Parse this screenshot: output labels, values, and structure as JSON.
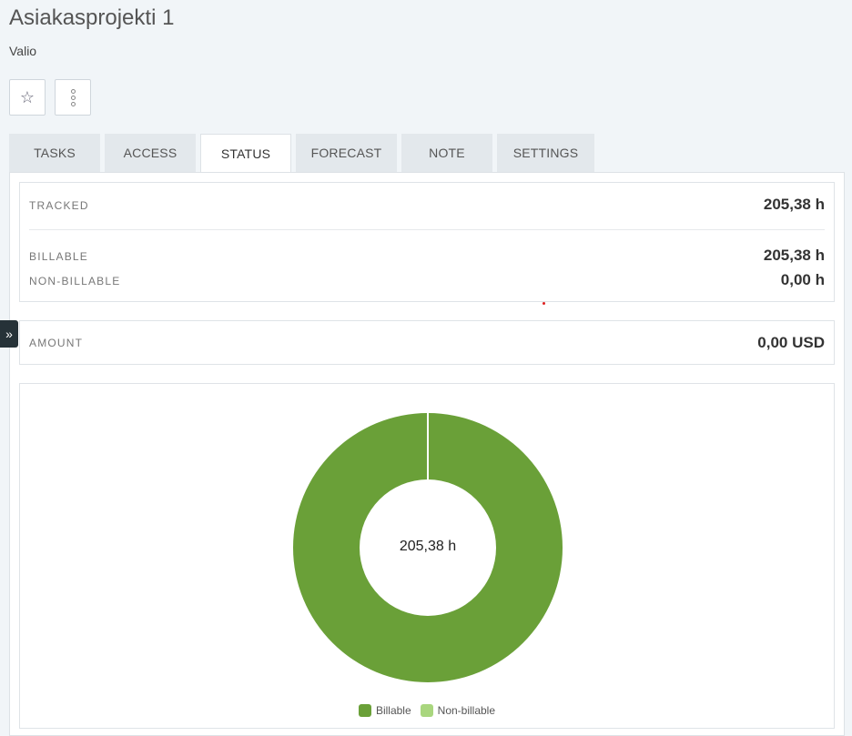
{
  "header": {
    "title": "Asiakasprojekti 1",
    "client": "Valio"
  },
  "actions": {
    "favorite_icon": "star-icon",
    "more_icon": "vertical-dots-icon",
    "star_glyph": "☆"
  },
  "tabs": [
    {
      "label": "TASKS",
      "active": false
    },
    {
      "label": "ACCESS",
      "active": false
    },
    {
      "label": "STATUS",
      "active": true
    },
    {
      "label": "FORECAST",
      "active": false
    },
    {
      "label": "NOTE",
      "active": false
    },
    {
      "label": "SETTINGS",
      "active": false
    }
  ],
  "hours": {
    "tracked_label": "TRACKED",
    "tracked_value": "205,38 h",
    "billable_label": "BILLABLE",
    "billable_value": "205,38 h",
    "nonbillable_label": "NON-BILLABLE",
    "nonbillable_value": "0,00 h"
  },
  "amount": {
    "label": "AMOUNT",
    "value": "0,00 USD"
  },
  "sidebar_toggle": {
    "icon": "double-chevron-right-icon",
    "glyph": "»"
  },
  "chart_data": {
    "type": "pie",
    "center_label": "205,38 h",
    "categories": [
      "Billable",
      "Non-billable"
    ],
    "values": [
      205.38,
      0.0
    ],
    "colors": [
      "#6aa038",
      "#a9d67e"
    ],
    "legend_position": "bottom"
  }
}
